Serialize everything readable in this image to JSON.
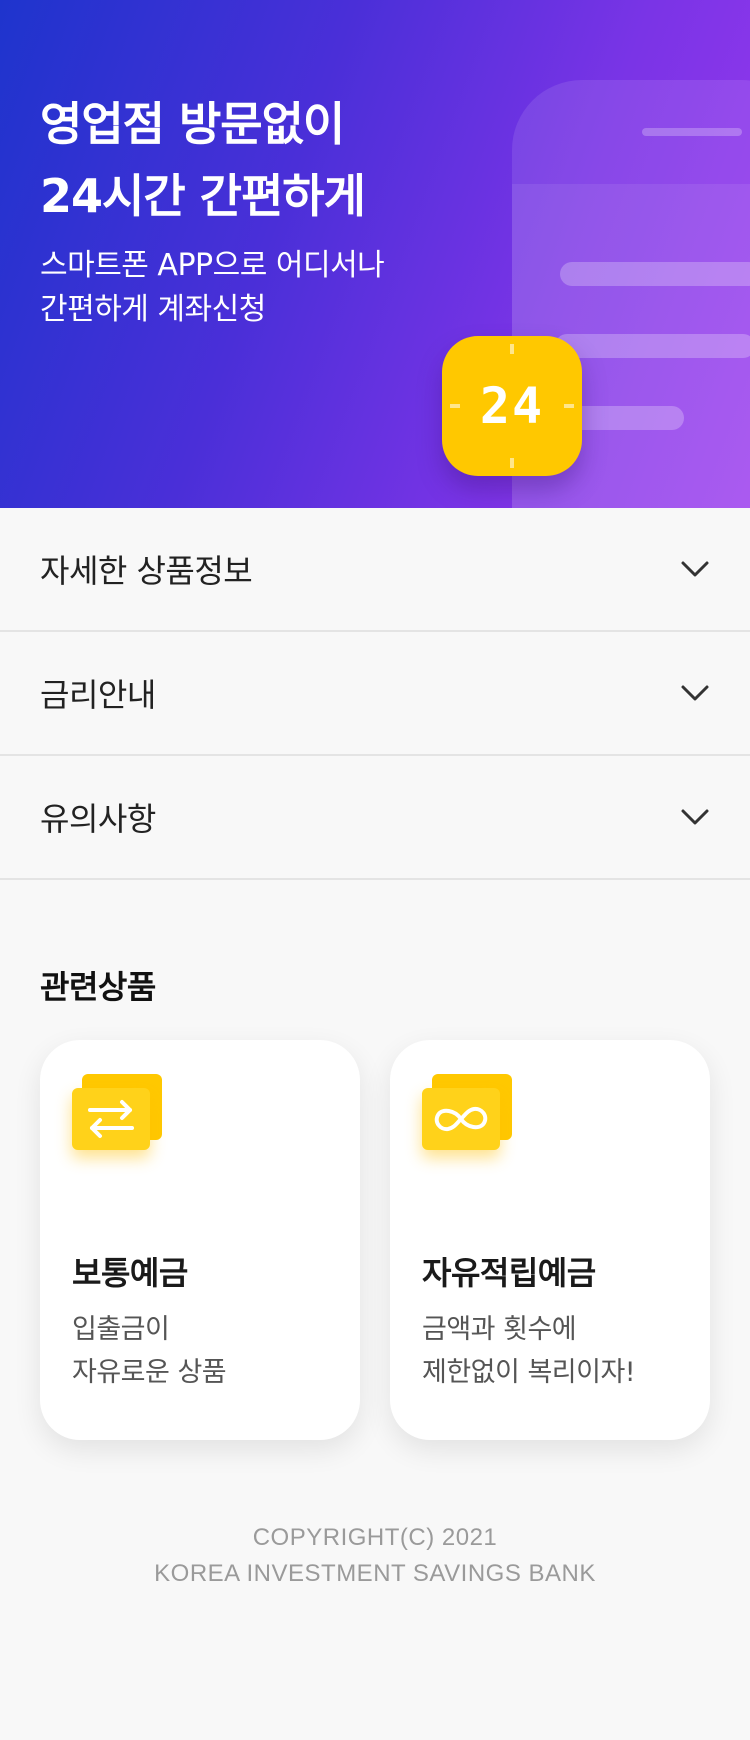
{
  "hero": {
    "title_lines": [
      "영업점 방문없이",
      "24시간 간편하게"
    ],
    "subtitle_lines": [
      "스마트폰 APP으로 어디서나",
      "간편하게 계좌신청"
    ],
    "badge_text": "24",
    "badge_color": "#ffc800",
    "gradient_colors": [
      "#1e34cd",
      "#9a38ee"
    ]
  },
  "accordion": {
    "items": [
      {
        "label": "자세한 상품정보",
        "icon": "chevron-down-icon"
      },
      {
        "label": "금리안내",
        "icon": "chevron-down-icon"
      },
      {
        "label": "유의사항",
        "icon": "chevron-down-icon"
      }
    ]
  },
  "related": {
    "title": "관련상품",
    "cards": [
      {
        "title": "보통예금",
        "desc_lines": [
          "입출금이",
          "자유로운 상품"
        ],
        "icon": "transfer-arrows-icon"
      },
      {
        "title": "자유적립예금",
        "desc_lines": [
          "금액과 횟수에",
          "제한없이 복리이자!"
        ],
        "icon": "infinity-icon"
      }
    ]
  },
  "footer": {
    "lines": [
      "COPYRIGHT(C) 2021",
      "KOREA INVESTMENT SAVINGS BANK"
    ]
  },
  "colors": {
    "accent_yellow": "#ffc800",
    "text_dark": "#222222",
    "text_muted": "#555555",
    "footer_text": "#9a9a9a"
  }
}
